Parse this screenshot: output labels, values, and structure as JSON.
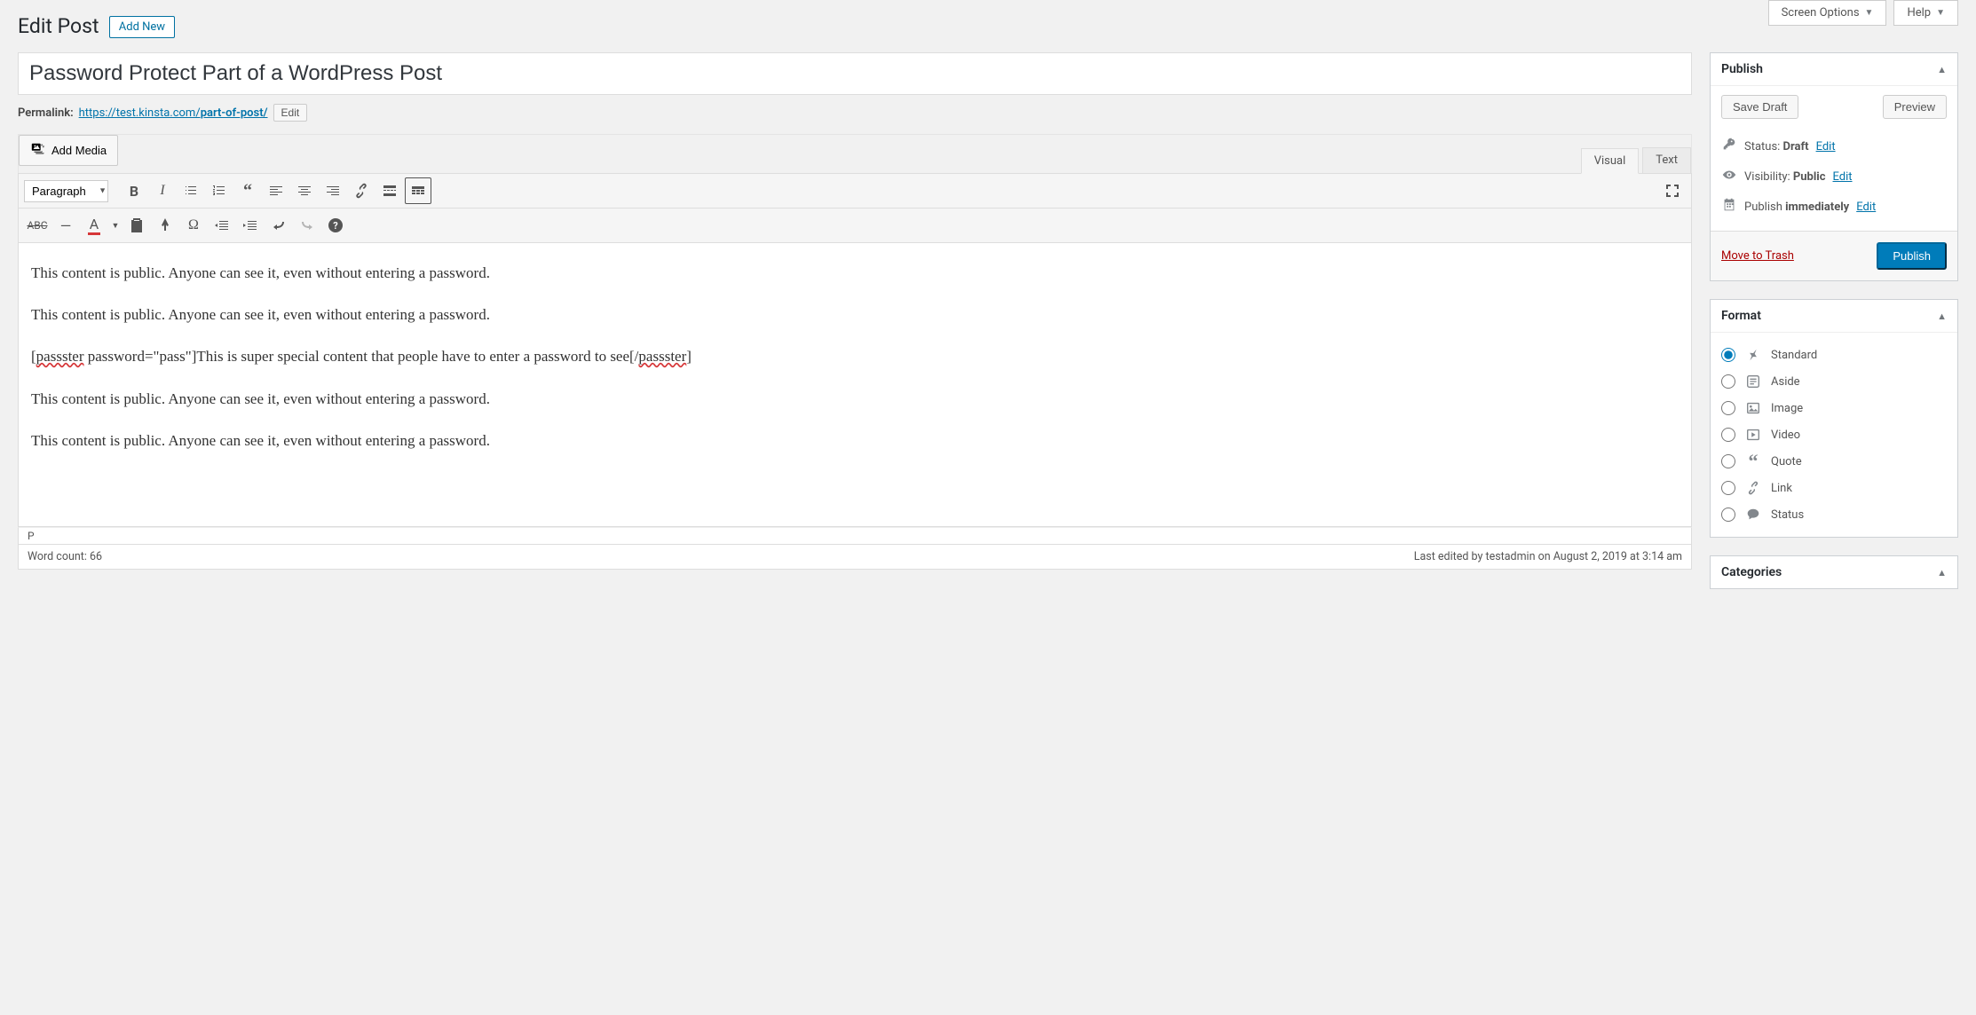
{
  "header": {
    "screen_options": "Screen Options",
    "help": "Help",
    "page_title": "Edit Post",
    "add_new": "Add New"
  },
  "post": {
    "title": "Password Protect Part of a WordPress Post",
    "permalink_label": "Permalink:",
    "permalink_base": "https://test.kinsta.com/",
    "permalink_slug": "part-of-post/",
    "edit_btn": "Edit"
  },
  "editor": {
    "add_media": "Add Media",
    "tab_visual": "Visual",
    "tab_text": "Text",
    "format_dropdown": "Paragraph",
    "content_p1": "This content is public. Anyone can see it, even without entering a password.",
    "content_p2": "This content is public. Anyone can see it, even without entering a password.",
    "content_shortcode_open": "[",
    "content_shortcode_tag1": "passster",
    "content_shortcode_attrs": " password=\"pass\"]This is super special content that people have to enter a password to see[/",
    "content_shortcode_tag2": "passster",
    "content_shortcode_close": "]",
    "content_p4": "This content is public. Anyone can see it, even without entering a password.",
    "content_p5": "This content is public. Anyone can see it, even without entering a password.",
    "path": "P",
    "word_count_label": "Word count: ",
    "word_count": "66",
    "last_edited": "Last edited by testadmin on August 2, 2019 at 3:14 am"
  },
  "publish": {
    "title": "Publish",
    "save_draft": "Save Draft",
    "preview": "Preview",
    "status_label": "Status: ",
    "status_value": "Draft",
    "visibility_label": "Visibility: ",
    "visibility_value": "Public",
    "publish_label": "Publish ",
    "publish_value": "immediately",
    "edit_link": "Edit",
    "trash": "Move to Trash",
    "publish_btn": "Publish"
  },
  "format": {
    "title": "Format",
    "options": [
      {
        "label": "Standard",
        "icon": "pin"
      },
      {
        "label": "Aside",
        "icon": "aside"
      },
      {
        "label": "Image",
        "icon": "image"
      },
      {
        "label": "Video",
        "icon": "video"
      },
      {
        "label": "Quote",
        "icon": "quote"
      },
      {
        "label": "Link",
        "icon": "link"
      },
      {
        "label": "Status",
        "icon": "status"
      }
    ]
  },
  "categories": {
    "title": "Categories"
  }
}
